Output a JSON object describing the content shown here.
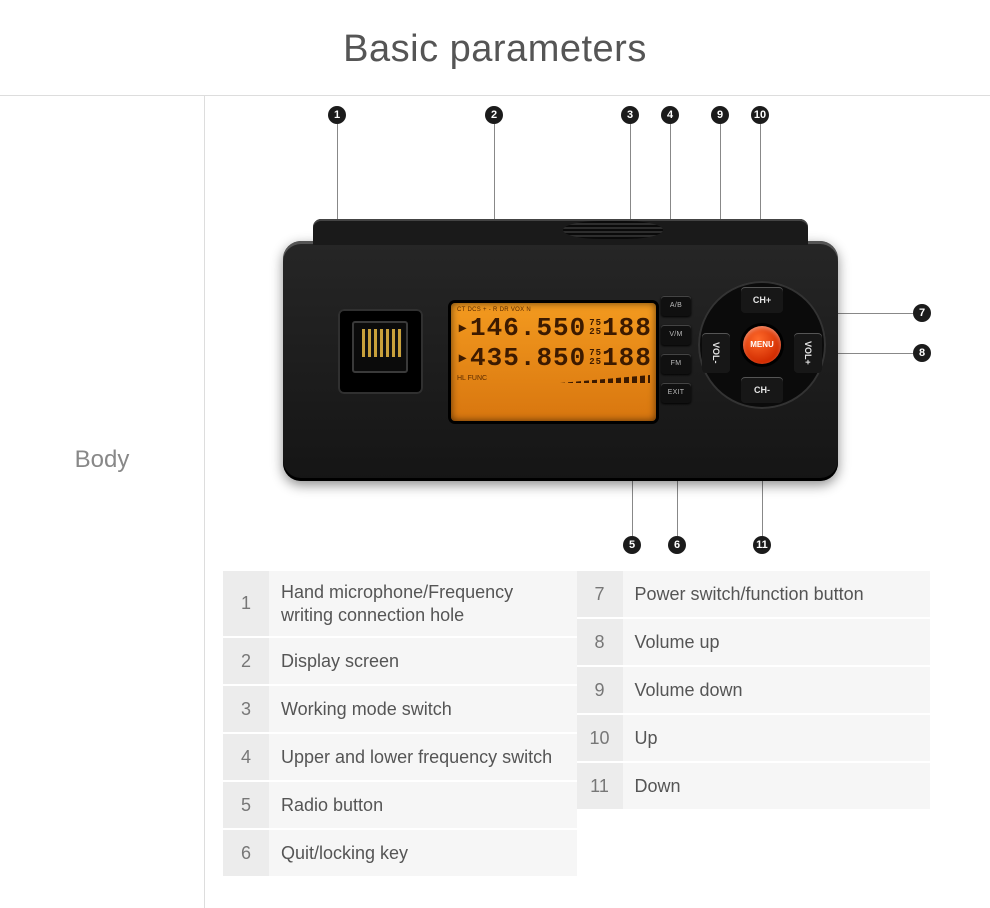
{
  "title": "Basic parameters",
  "section_label": "Body",
  "device": {
    "screen_top_indicators": "CT DCS + - R DR VOX N",
    "freq1": "146.550",
    "freq1_sub_top": "75",
    "freq1_sub_bot": "25",
    "freq1_ch": "188",
    "freq2": "435.850",
    "freq2_sub_top": "75",
    "freq2_sub_bot": "25",
    "freq2_ch": "188",
    "screen_bot_left": "HL  FUNC",
    "side_buttons": {
      "ab": "A/B",
      "vm": "V/M",
      "fm": "FM",
      "exit": "EXIT"
    },
    "dpad": {
      "up": "CH+",
      "down": "CH-",
      "left": "VOL-",
      "right": "VOL+",
      "center": "MENU"
    }
  },
  "callouts": [
    "1",
    "2",
    "3",
    "4",
    "5",
    "6",
    "7",
    "8",
    "9",
    "10",
    "11"
  ],
  "legend_left": [
    {
      "n": "1",
      "t": "Hand microphone/Frequency writing connection hole"
    },
    {
      "n": "2",
      "t": "Display screen"
    },
    {
      "n": "3",
      "t": "Working mode switch"
    },
    {
      "n": "4",
      "t": "Upper and lower frequency switch"
    },
    {
      "n": "5",
      "t": "Radio button"
    },
    {
      "n": "6",
      "t": "Quit/locking key"
    }
  ],
  "legend_right": [
    {
      "n": "7",
      "t": "Power switch/function button"
    },
    {
      "n": "8",
      "t": "Volume up"
    },
    {
      "n": "9",
      "t": "Volume down"
    },
    {
      "n": "10",
      "t": "Up"
    },
    {
      "n": "11",
      "t": "Down"
    }
  ]
}
